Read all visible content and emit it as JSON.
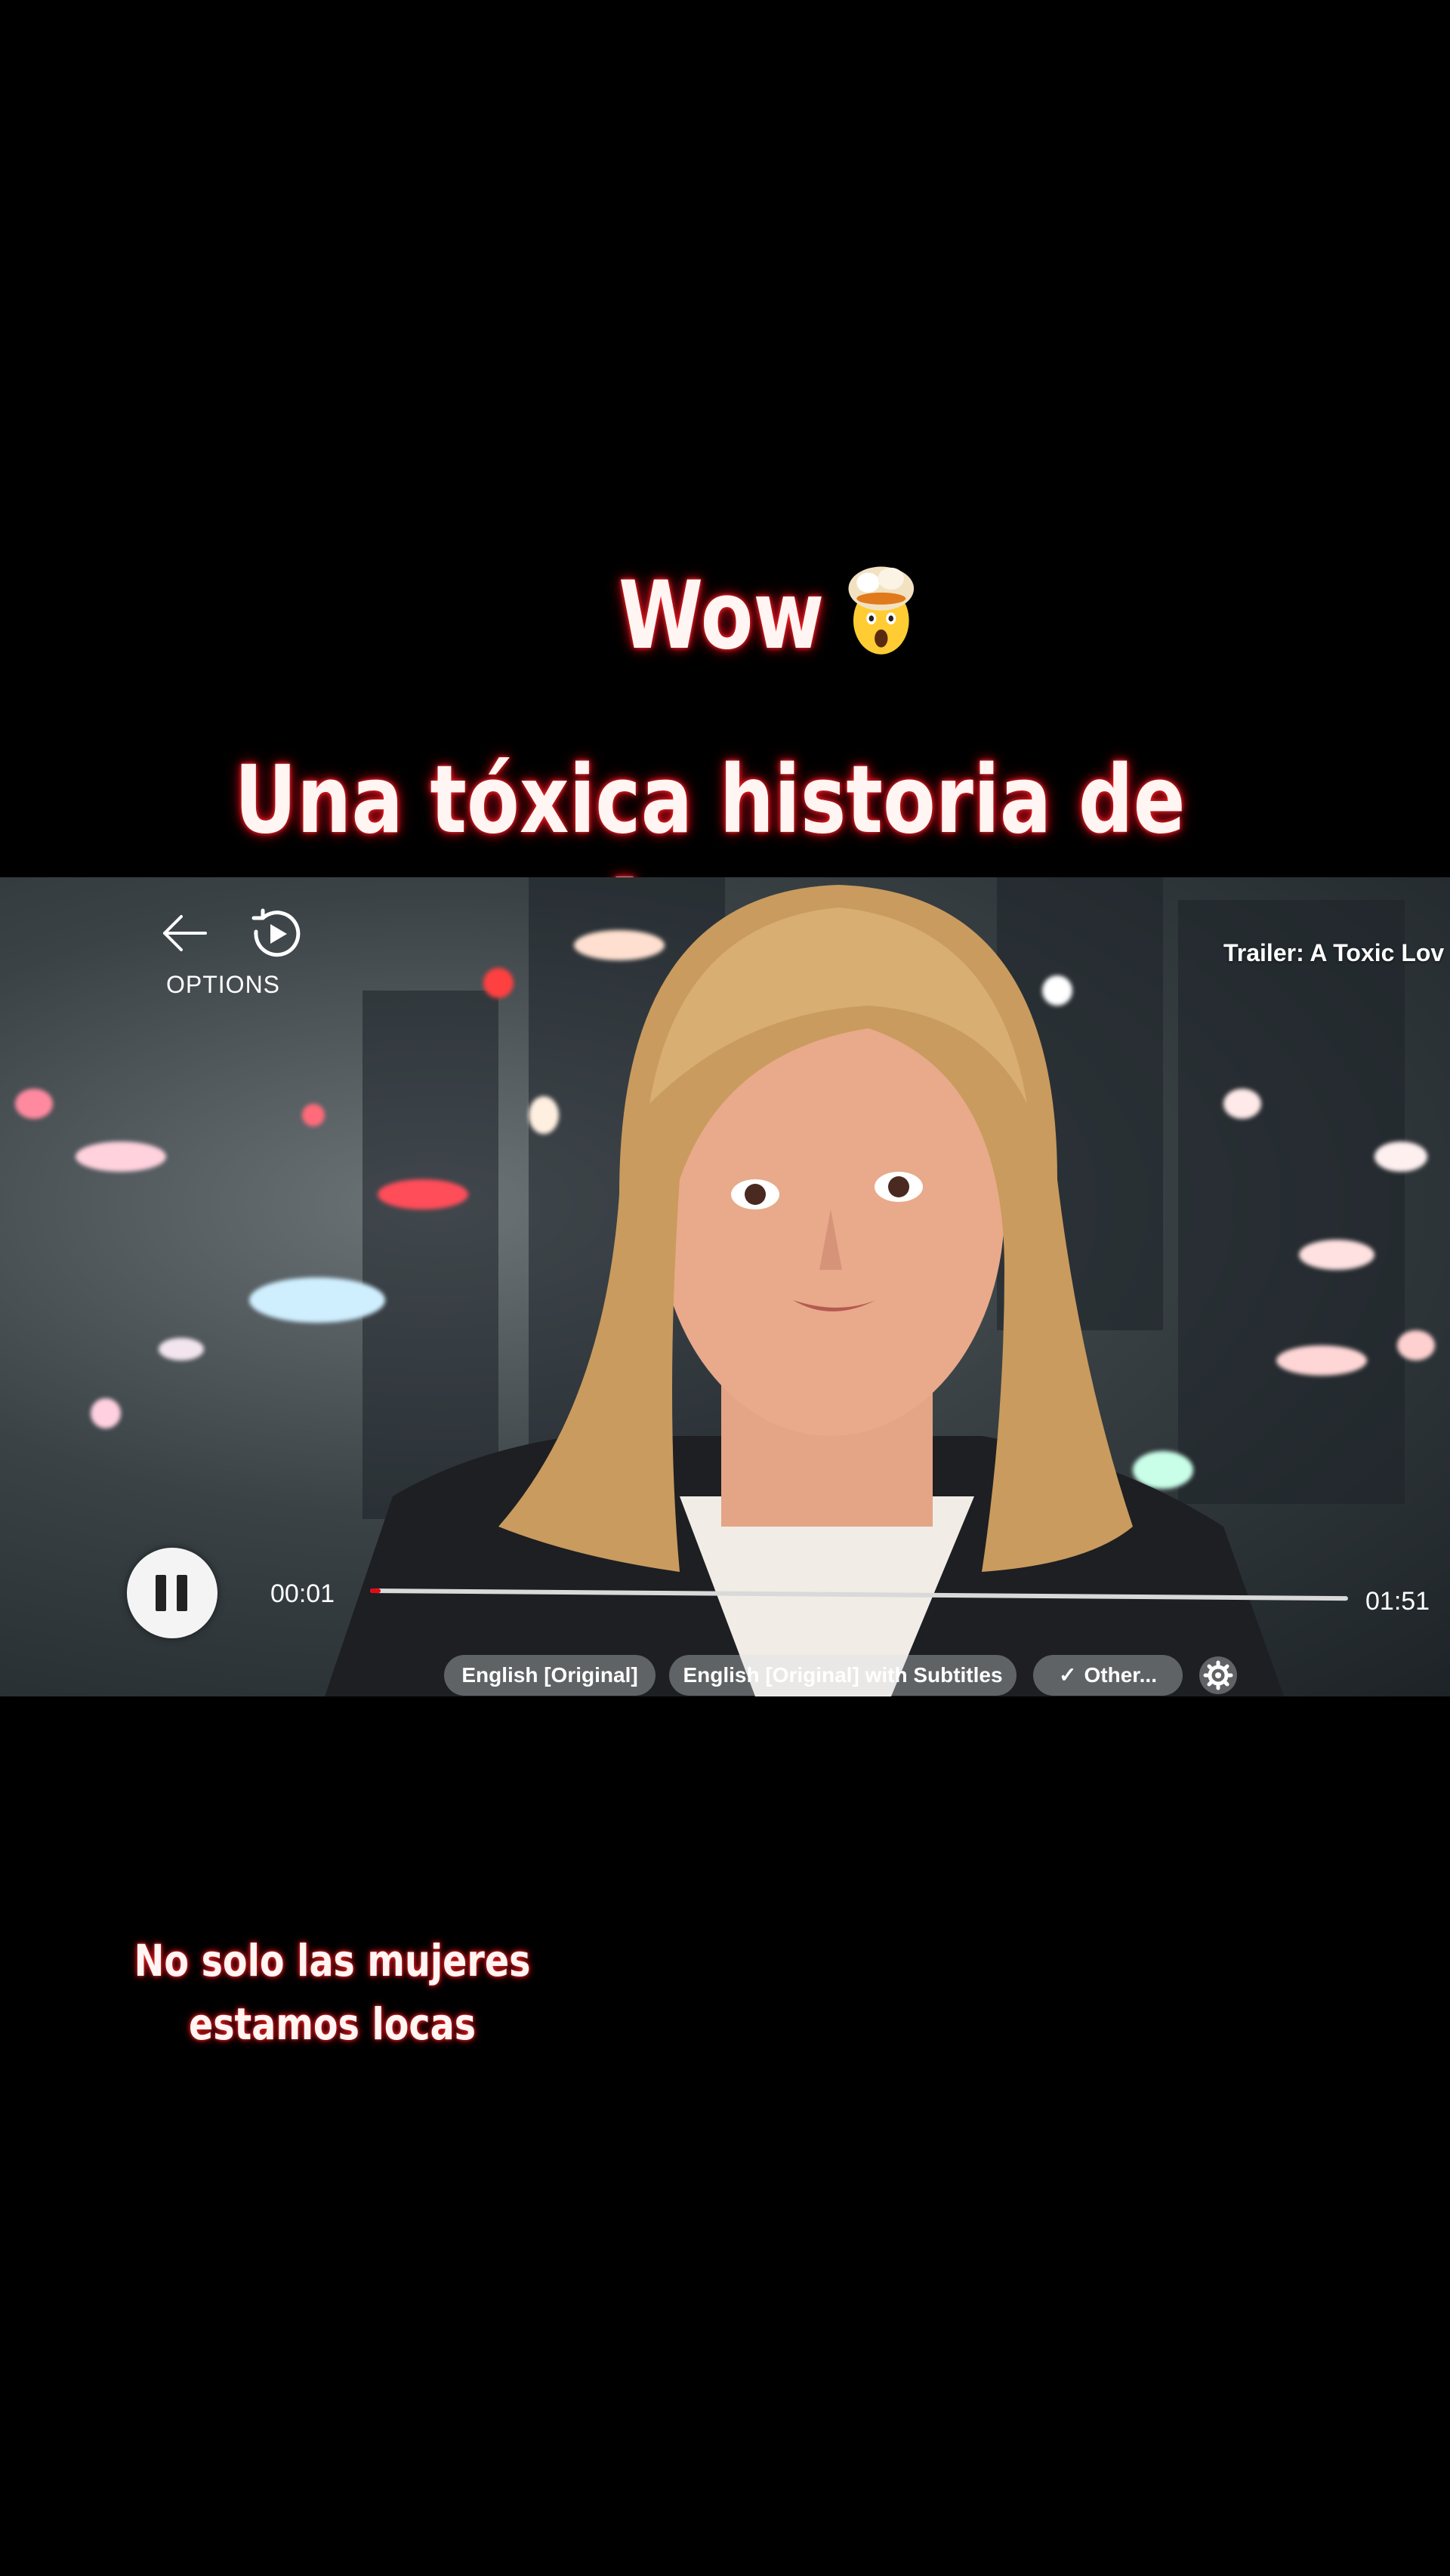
{
  "captions": {
    "wow": "Wow",
    "wow_emoji": "exploding-head-emoji",
    "title": "Una tóxica historia de Amor",
    "bottom": "No solo las mujeres estamos locas"
  },
  "player": {
    "back_icon": "back-arrow-icon",
    "replay_icon": "replay-icon",
    "options_label": "OPTIONS",
    "trailer_title": "Trailer: A Toxic Lov",
    "current_time": "00:01",
    "total_time": "01:51",
    "progress_fraction": 0.011,
    "pause_icon": "pause-icon",
    "audio_options": [
      "English [Original]",
      "English [Original] with Subtitles",
      "Other..."
    ],
    "selected_option_index": 2,
    "settings_icon": "gear-icon",
    "colors": {
      "progress_fill": "#e50914",
      "caption_glow": "#ff2a2a"
    }
  }
}
